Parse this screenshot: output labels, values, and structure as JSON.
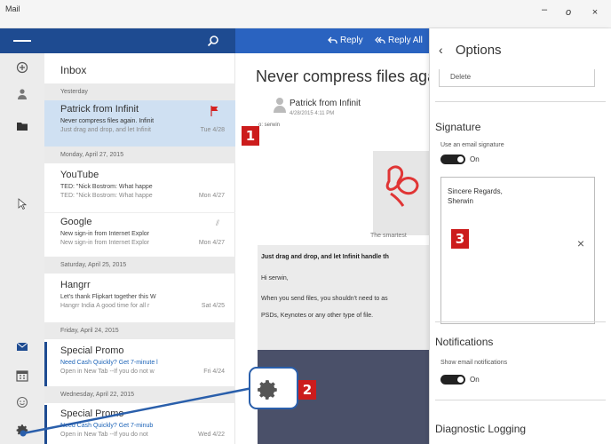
{
  "window": {
    "app_title": "Mail",
    "minimize": "–",
    "maximize": "o",
    "close": "×"
  },
  "message_list": {
    "folder": "Inbox",
    "groups": {
      "yesterday": "Yesterday",
      "apr27": "Monday, April 27, 2015",
      "apr25": "Saturday, April 25, 2015",
      "apr24": "Friday, April 24, 2015",
      "apr22": "Wednesday, April 22, 2015"
    },
    "messages": [
      {
        "from": "Patrick from Infinit",
        "subject": "Never compress files again. Infinit",
        "preview": "Just drag and drop, and let Infinit",
        "date": "Tue 4/28"
      },
      {
        "from": "YouTube",
        "subject": "TED: \"Nick Bostrom: What happe",
        "preview": "TED: \"Nick Bostrom: What happe",
        "date": "Mon 4/27"
      },
      {
        "from": "Google",
        "subject": "New sign-in from Internet Explor",
        "preview": "New sign-in from Internet Explor",
        "date": "Mon 4/27"
      },
      {
        "from": "Hangrr",
        "subject": "Let's thank Flipkart together this W",
        "preview": "Hangrr India A good time for all r",
        "date": "Sat 4/25"
      },
      {
        "from": "Special Promo",
        "subject": "Need Cash Quickly? Get 7-minute l",
        "preview": "Open in New Tab --If you do not w",
        "date": "Fri 4/24"
      },
      {
        "from": "Special Promo",
        "subject": "Need Cash Quickly? Get 7-minub",
        "preview": "Open in New Tab --If you do not",
        "date": "Wed 4/22"
      }
    ]
  },
  "reading": {
    "reply": "Reply",
    "reply_all": "Reply All",
    "subject": "Never compress files aga",
    "sender": "Patrick from Infinit",
    "sent": "4/28/2015 4:11 PM",
    "to": "o: serwin",
    "tagline": "The smartest",
    "body_heading": "Just drag and drop, and let Infinit handle th",
    "greeting": "Hi serwin,",
    "body_line1": "When you send files, you shouldn't need to as",
    "body_line2": "PSDs, Keynotes or any other type of file."
  },
  "options": {
    "back": "‹",
    "title": "Options",
    "delete_value": "Delete",
    "signature": {
      "heading": "Signature",
      "toggle_label": "Use an email signature",
      "toggle_state": "On",
      "text_line1": "Sincere Regards,",
      "text_line2": "Sherwin",
      "clear": "×"
    },
    "notifications": {
      "heading": "Notifications",
      "toggle_label": "Show email notifications",
      "toggle_state": "On"
    },
    "diagnostic": {
      "heading": "Diagnostic Logging"
    }
  },
  "annotations": {
    "badge1": "1",
    "badge2": "2",
    "badge3": "3",
    "color": "#cc1c1c"
  },
  "colors": {
    "accent_dark": "#1e4b91",
    "accent": "#2a63c0",
    "selected": "#cfe0f2"
  }
}
